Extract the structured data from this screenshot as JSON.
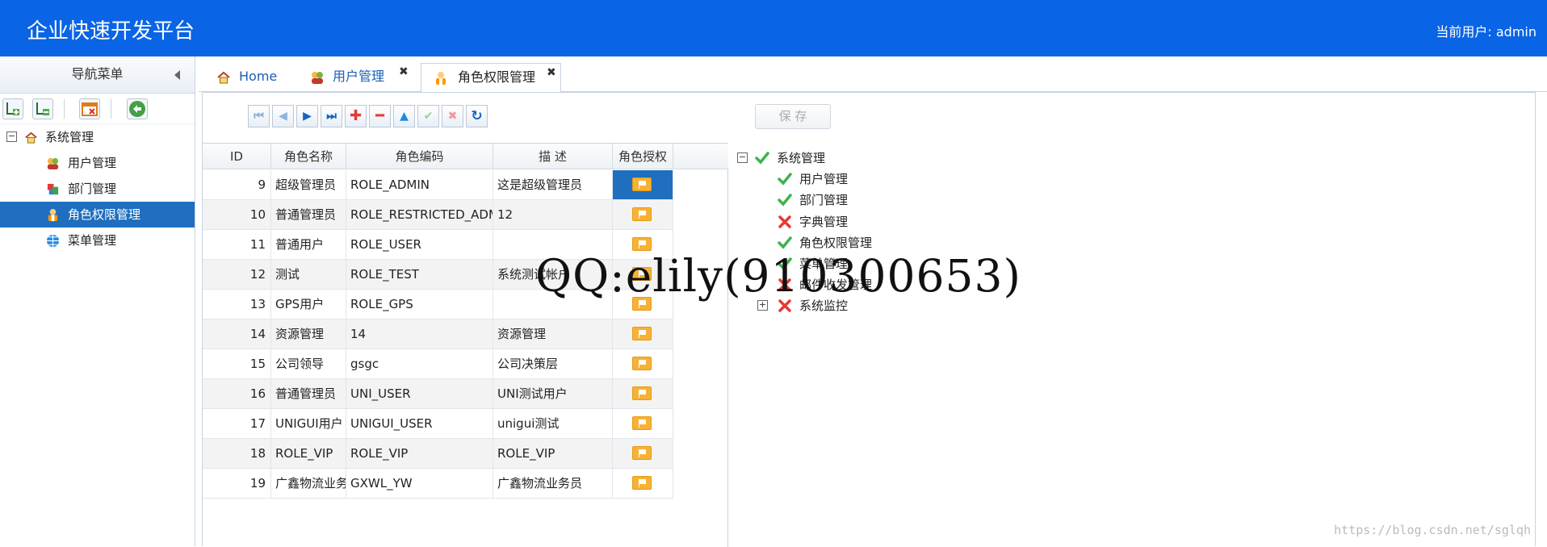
{
  "header": {
    "title": "企业快速开发平台",
    "current_user": "当前用户: admin"
  },
  "nav": {
    "title": "导航菜单",
    "root": {
      "label": "系统管理",
      "toggle": "−"
    },
    "items": [
      {
        "label": "用户管理",
        "icon": "users-icon"
      },
      {
        "label": "部门管理",
        "icon": "department-icon"
      },
      {
        "label": "角色权限管理",
        "icon": "role-user-icon",
        "active": true
      },
      {
        "label": "菜单管理",
        "icon": "grid-globe-icon"
      }
    ]
  },
  "tabs": [
    {
      "label": "Home",
      "icon": "home-icon",
      "closable": false
    },
    {
      "label": "用户管理",
      "icon": "users-icon",
      "closable": true
    },
    {
      "label": "角色权限管理",
      "icon": "role-user-icon",
      "closable": true,
      "active": true
    }
  ],
  "toolbar": {
    "buttons": [
      "first-page",
      "prev-page",
      "next-page",
      "last-page",
      "add",
      "remove",
      "move-up",
      "confirm",
      "cancel",
      "refresh"
    ],
    "save_label": "保 存"
  },
  "grid": {
    "columns": [
      "ID",
      "角色名称",
      "角色编码",
      "描 述",
      "角色授权"
    ],
    "rows": [
      {
        "id": "9",
        "name": "超级管理员",
        "code": "ROLE_ADMIN",
        "desc": "这是超级管理员",
        "selected": true
      },
      {
        "id": "10",
        "name": "普通管理员",
        "code": "ROLE_RESTRICTED_ADMIN",
        "desc": "12"
      },
      {
        "id": "11",
        "name": "普通用户",
        "code": "ROLE_USER",
        "desc": ""
      },
      {
        "id": "12",
        "name": "测试",
        "code": "ROLE_TEST",
        "desc": "系统测试帐户"
      },
      {
        "id": "13",
        "name": "GPS用户",
        "code": "ROLE_GPS",
        "desc": ""
      },
      {
        "id": "14",
        "name": "资源管理",
        "code": "14",
        "desc": "资源管理"
      },
      {
        "id": "15",
        "name": "公司领导",
        "code": "gsgc",
        "desc": "公司决策层"
      },
      {
        "id": "16",
        "name": "普通管理员",
        "code": "UNI_USER",
        "desc": "UNI测试用户"
      },
      {
        "id": "17",
        "name": "UNIGUI用户",
        "code": "UNIGUI_USER",
        "desc": "unigui测试"
      },
      {
        "id": "18",
        "name": "ROLE_VIP",
        "code": "ROLE_VIP",
        "desc": "ROLE_VIP"
      },
      {
        "id": "19",
        "name": "广鑫物流业务员",
        "code": "GXWL_YW",
        "desc": "广鑫物流业务员"
      }
    ]
  },
  "permission_tree": [
    {
      "label": "系统管理",
      "checked": true,
      "toggle": "−",
      "level": 0
    },
    {
      "label": "用户管理",
      "checked": true,
      "level": 1
    },
    {
      "label": "部门管理",
      "checked": true,
      "level": 1
    },
    {
      "label": "字典管理",
      "checked": false,
      "level": 1
    },
    {
      "label": "角色权限管理",
      "checked": true,
      "level": 1
    },
    {
      "label": "菜单管理",
      "checked": true,
      "level": 1
    },
    {
      "label": "邮件收发管理",
      "checked": false,
      "level": 1
    },
    {
      "label": "系统监控",
      "checked": false,
      "toggle": "+",
      "level": 1
    }
  ],
  "watermark": "QQ:elily(910300653)",
  "source_mark": "https://blog.csdn.net/sglqh",
  "colors": {
    "header": "#0a64e6",
    "selection": "#1f6fbe",
    "flag": "#f7b236",
    "check": "#3bb54a",
    "cross": "#e53935"
  }
}
